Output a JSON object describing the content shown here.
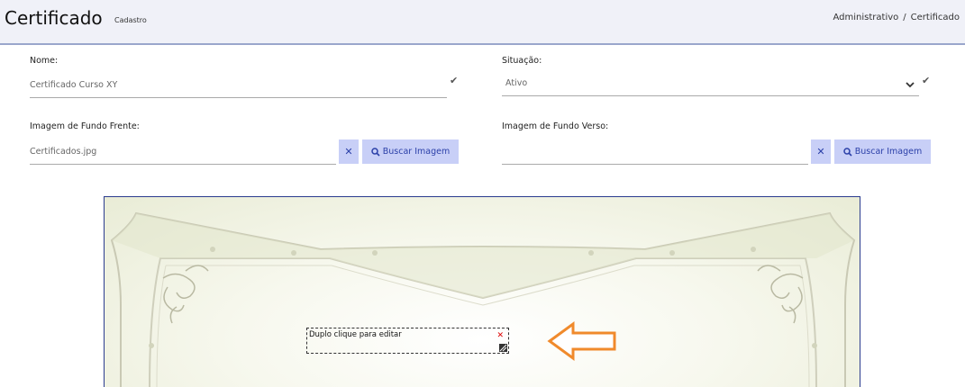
{
  "header": {
    "title": "Certificado",
    "subtitle": "Cadastro",
    "breadcrumb": [
      "Administrativo",
      "Certificado"
    ],
    "breadcrumb_separator": "/"
  },
  "form": {
    "nome": {
      "label": "Nome:",
      "value": "Certificado Curso XY"
    },
    "situacao": {
      "label": "Situação:",
      "value": "Ativo"
    },
    "imagem_frente": {
      "label": "Imagem de Fundo Frente:",
      "value": "Certificados.jpg",
      "search_label": "Buscar Imagem"
    },
    "imagem_verso": {
      "label": "Imagem de Fundo Verso:",
      "value": "",
      "search_label": "Buscar Imagem"
    }
  },
  "canvas": {
    "textbox_text": "Duplo clique para editar"
  },
  "icons": {
    "check": "check-icon",
    "chevron": "chevron-down-icon",
    "clear": "close-icon",
    "search": "search-icon",
    "arrow": "arrow-left-icon"
  },
  "colors": {
    "button_bg": "#c8cff7",
    "button_text": "#2a3fa8",
    "arrow": "#f08a2c",
    "header_bg": "#f0f1f8"
  }
}
